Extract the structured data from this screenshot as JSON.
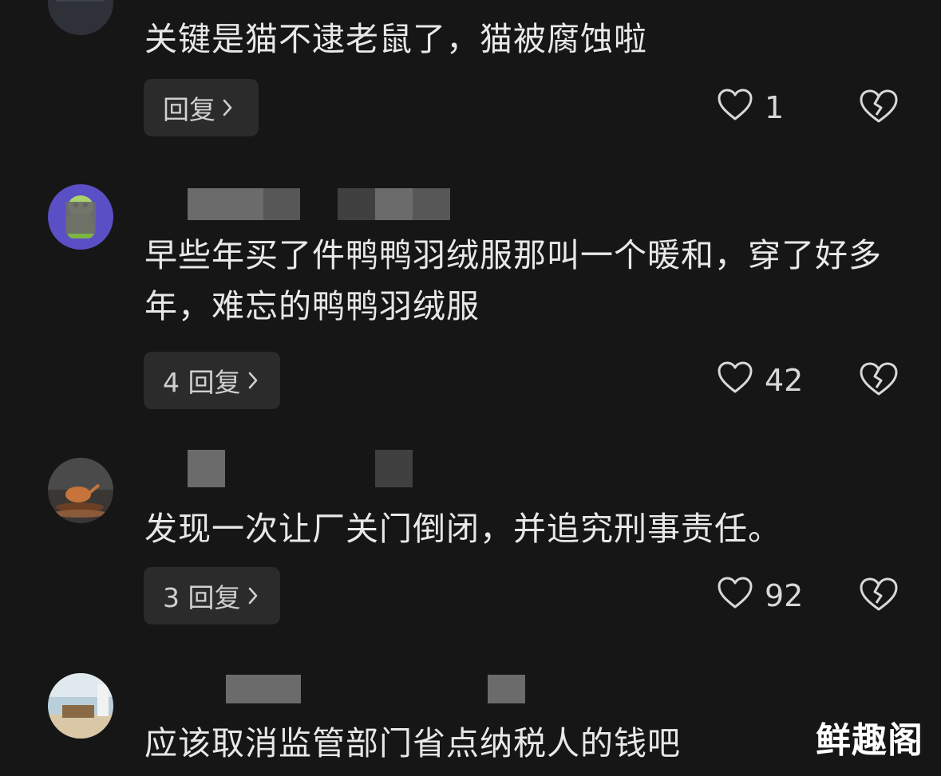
{
  "comments": [
    {
      "text": "关键是猫不逮老鼠了，猫被腐蚀啦",
      "reply_label": "回复",
      "likes": "1"
    },
    {
      "text": "早些年买了件鸭鸭羽绒服那叫一个暖和，穿了好多年，难忘的鸭鸭羽绒服",
      "reply_label": "4 回复",
      "likes": "42"
    },
    {
      "text": "发现一次让厂关门倒闭，并追究刑事责任。",
      "reply_label": "3 回复",
      "likes": "92"
    },
    {
      "text": "应该取消监管部门省点纳税人的钱吧"
    }
  ],
  "watermark": "鲜趣阁",
  "colors": {
    "background": "#161616",
    "button": "#2b2b2b",
    "text": "#e8e8e8"
  },
  "icons": [
    "heart-icon",
    "broken-heart-icon",
    "chevron-right-icon"
  ]
}
